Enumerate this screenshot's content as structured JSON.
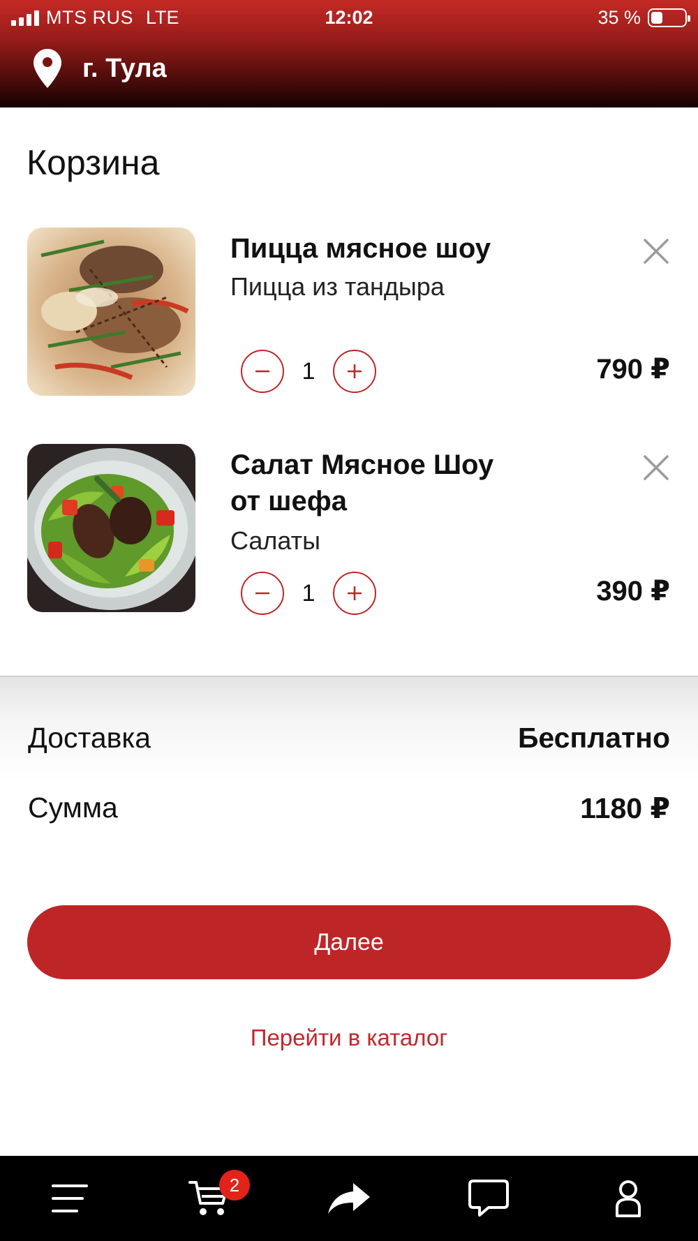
{
  "status_bar": {
    "carrier": "MTS RUS",
    "network": "LTE",
    "time": "12:02",
    "battery_text": "35 %",
    "battery_level": 0.35,
    "signal_bars": 4
  },
  "header": {
    "location_icon": "map-pin-icon",
    "city": "г. Тула"
  },
  "page_title": "Корзина",
  "cart": {
    "items": [
      {
        "name": "Пицца мясное шоу",
        "category": "Пицца из тандыра",
        "quantity": "1",
        "price": "790 ₽",
        "image": "meat-pizza-photo"
      },
      {
        "name": "Салат Мясное Шоу от шефа",
        "category": "Салаты",
        "quantity": "1",
        "price": "390 ₽",
        "image": "meat-salad-photo"
      }
    ]
  },
  "summary": {
    "delivery_label": "Доставка",
    "delivery_value": "Бесплатно",
    "total_label": "Сумма",
    "total_value": "1180 ₽"
  },
  "actions": {
    "next_label": "Далее",
    "catalog_label": "Перейти в каталог"
  },
  "tabbar": {
    "items": [
      {
        "icon": "menu-icon"
      },
      {
        "icon": "cart-icon",
        "badge": "2"
      },
      {
        "icon": "share-icon"
      },
      {
        "icon": "chat-icon"
      },
      {
        "icon": "profile-icon"
      }
    ]
  },
  "colors": {
    "accent": "#be2527",
    "header_top": "#c42a26",
    "header_bottom": "#140202",
    "badge": "#e2231a"
  }
}
